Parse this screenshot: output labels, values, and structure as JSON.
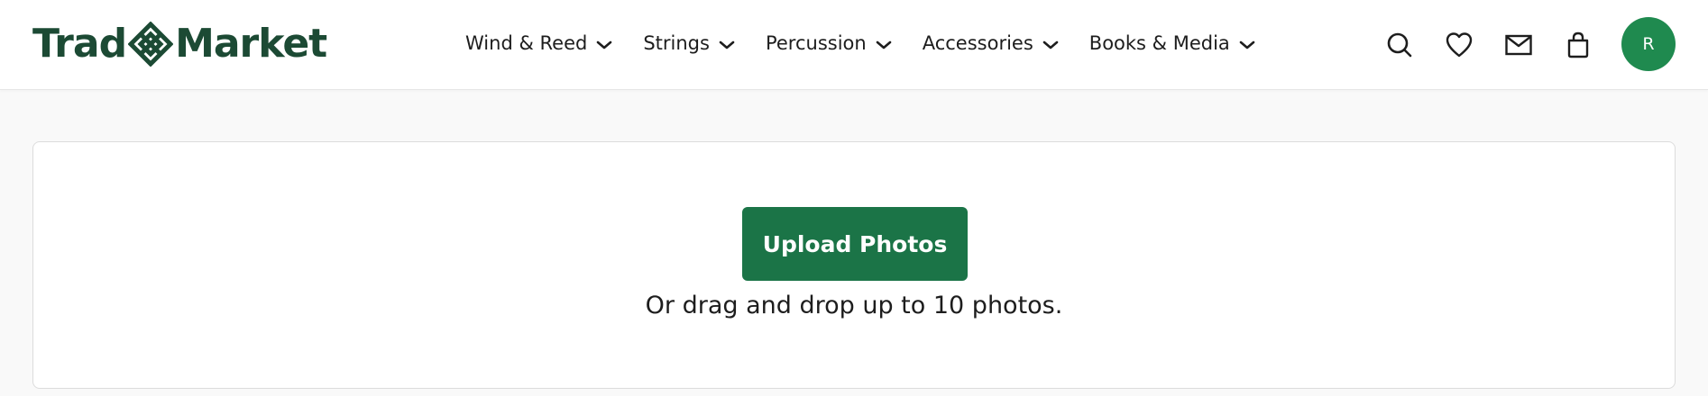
{
  "brand": {
    "name_left": "Trad",
    "name_right": "Market",
    "logo_icon": "celtic-knot-icon",
    "color": "#1c4a34"
  },
  "nav": {
    "items": [
      {
        "label": "Wind & Reed",
        "icon": "chevron-down-icon"
      },
      {
        "label": "Strings",
        "icon": "chevron-down-icon"
      },
      {
        "label": "Percussion",
        "icon": "chevron-down-icon"
      },
      {
        "label": "Accessories",
        "icon": "chevron-down-icon"
      },
      {
        "label": "Books & Media",
        "icon": "chevron-down-icon"
      }
    ]
  },
  "header_icons": [
    "search-icon",
    "heart-icon",
    "mail-icon",
    "shopping-bag-icon"
  ],
  "user": {
    "avatar_initial": "R",
    "avatar_color": "#1f8a4f"
  },
  "upload": {
    "button_label": "Upload Photos",
    "hint": "Or drag and drop up to 10 photos.",
    "button_color": "#1b7447"
  }
}
